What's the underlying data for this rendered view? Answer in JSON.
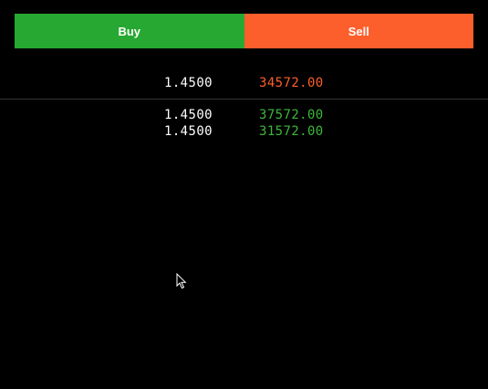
{
  "actions": {
    "buy_label": "Buy",
    "sell_label": "Sell"
  },
  "colors": {
    "buy": "#27a832",
    "sell": "#fd5f2c",
    "bid_text": "#3db83a",
    "ask_text": "#fd5f2c",
    "background": "#000000"
  },
  "asks": [
    {
      "price": "1.4500",
      "amount": "34572.00"
    }
  ],
  "bids": [
    {
      "price": "1.4500",
      "amount": "37572.00"
    },
    {
      "price": "1.4500",
      "amount": "31572.00"
    }
  ]
}
